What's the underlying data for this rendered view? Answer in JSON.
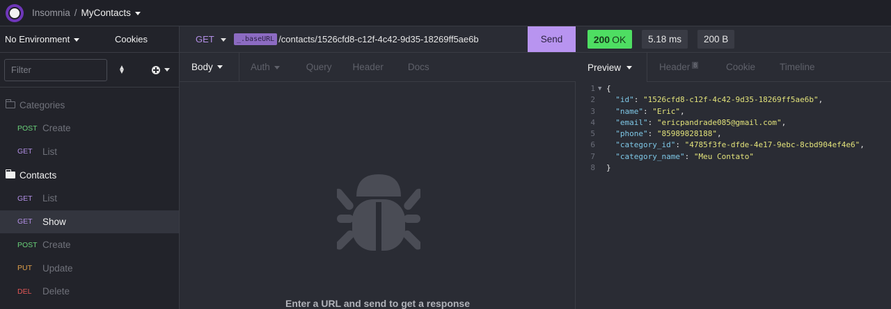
{
  "header": {
    "workspace": "Insomnia",
    "separator": "/",
    "collection": "MyContacts"
  },
  "sidebar": {
    "environment": "No Environment",
    "cookies_label": "Cookies",
    "filter_placeholder": "Filter",
    "folders": [
      {
        "label": "Categories",
        "expanded": false,
        "requests": [
          {
            "method": "POST",
            "name": "Create"
          },
          {
            "method": "GET",
            "name": "List"
          }
        ]
      },
      {
        "label": "Contacts",
        "expanded": true,
        "requests": [
          {
            "method": "GET",
            "name": "List"
          },
          {
            "method": "GET",
            "name": "Show",
            "active": true
          },
          {
            "method": "POST",
            "name": "Create"
          },
          {
            "method": "PUT",
            "name": "Update"
          },
          {
            "method": "DEL",
            "name": "Delete"
          }
        ]
      }
    ]
  },
  "request": {
    "method": "GET",
    "base_tag": "_.baseURL",
    "path": "/contacts/1526cfd8-c12f-4c42-9d35-18269ff5ae6b",
    "send_label": "Send",
    "tabs": [
      "Body",
      "Auth",
      "Query",
      "Header",
      "Docs"
    ],
    "empty_message": "Enter a URL and send to get a response"
  },
  "response": {
    "status_code": "200",
    "status_text": "OK",
    "time": "5.18 ms",
    "size": "200 B",
    "tabs": [
      "Preview",
      "Header",
      "Cookie",
      "Timeline"
    ],
    "header_count": "8",
    "json_lines": {
      "l1": "{",
      "id_key": "\"id\"",
      "id_val": "\"1526cfd8-c12f-4c42-9d35-18269ff5ae6b\"",
      "name_key": "\"name\"",
      "name_val": "\"Eric\"",
      "email_key": "\"email\"",
      "email_val": "\"ericpandrade085@gmail.com\"",
      "phone_key": "\"phone\"",
      "phone_val": "\"85989828188\"",
      "cat_key": "\"category_id\"",
      "cat_val": "\"4785f3fe-dfde-4e17-9ebc-8cbd904ef4e6\"",
      "catname_key": "\"category_name\"",
      "catname_val": "\"Meu Contato\"",
      "l8": "}"
    },
    "line_numbers": [
      "1",
      "2",
      "3",
      "4",
      "5",
      "6",
      "7",
      "8"
    ]
  },
  "colors": {
    "accent": "#b894f0",
    "status_ok": "#4ede62",
    "get": "#b38fe6",
    "post": "#6ad27a",
    "put": "#e0a04a",
    "del": "#e65757"
  }
}
